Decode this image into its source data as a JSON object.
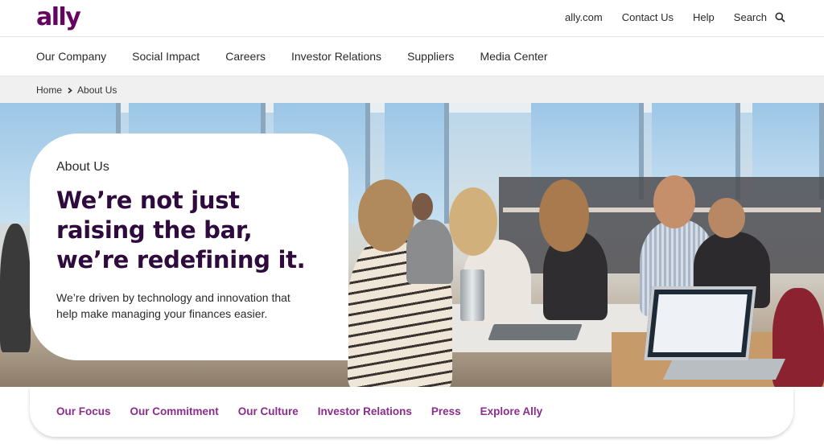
{
  "brand": {
    "logo_text": "ally",
    "color": "#650360"
  },
  "utility_nav": {
    "links": [
      "ally.com",
      "Contact Us",
      "Help"
    ],
    "search_label": "Search",
    "search_icon": "search-icon"
  },
  "main_nav": {
    "items": [
      "Our Company",
      "Social Impact",
      "Careers",
      "Investor Relations",
      "Suppliers",
      "Media Center"
    ]
  },
  "breadcrumb": {
    "items": [
      "Home",
      "About Us"
    ],
    "separator_icon": "chevron-right-icon"
  },
  "hero": {
    "eyebrow": "About Us",
    "title": "We’re not just raising the bar, we’re redefining it.",
    "description": "We’re driven by technology and innovation that help make managing your finances easier."
  },
  "anchor_nav": {
    "items": [
      "Our Focus",
      "Our Commitment",
      "Our Culture",
      "Investor Relations",
      "Press",
      "Explore Ally"
    ],
    "color": "#8b2d8c"
  },
  "colors": {
    "title": "#2e0b3c",
    "breadcrumb_bg": "#f0f0f0"
  }
}
